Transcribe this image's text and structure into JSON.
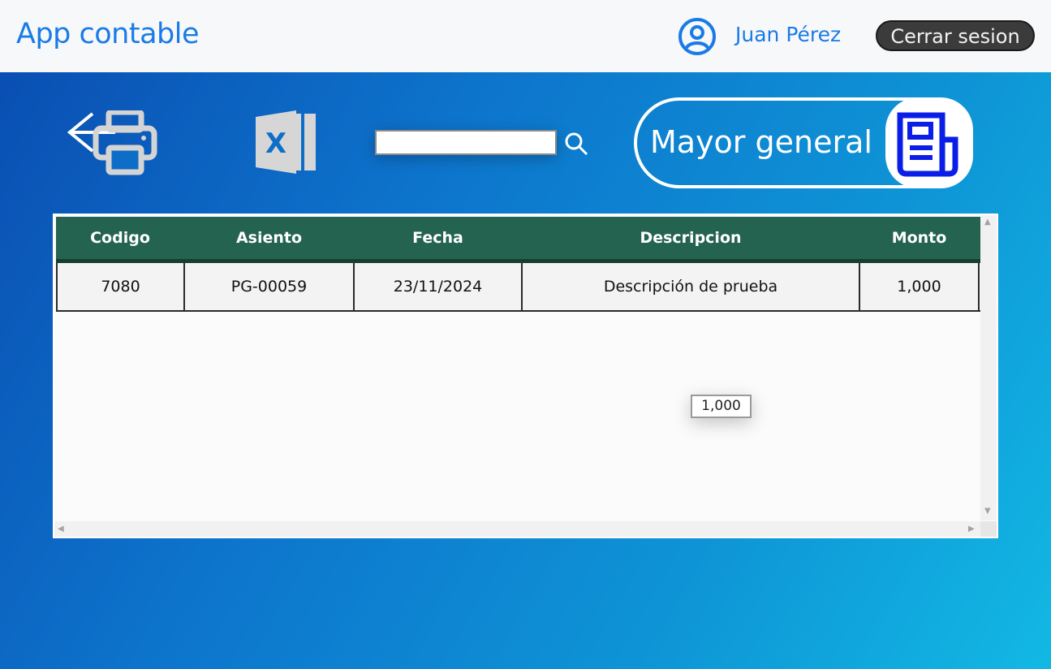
{
  "header": {
    "app_title": "App contable",
    "user_name": "Juan Pérez",
    "logout_label": "Cerrar sesion"
  },
  "toolbar": {
    "search": {
      "value": "",
      "placeholder": ""
    },
    "ledger_label": "Mayor general"
  },
  "table": {
    "columns": [
      "Codigo",
      "Asiento",
      "Fecha",
      "Descripcion",
      "Monto"
    ],
    "rows": [
      [
        "7080",
        "PG-00059",
        "23/11/2024",
        "Descripción de prueba",
        "1,000"
      ]
    ]
  },
  "tooltip": "1,000",
  "colors": {
    "brand_blue": "#1a7be6",
    "table_header": "#246350",
    "icon_blue": "#0a1ee8"
  },
  "icons": {
    "user": "user-circle-icon",
    "back": "arrow-left-icon",
    "print": "printer-icon",
    "excel": "excel-icon",
    "search": "search-icon",
    "ledger": "newspaper-icon"
  }
}
